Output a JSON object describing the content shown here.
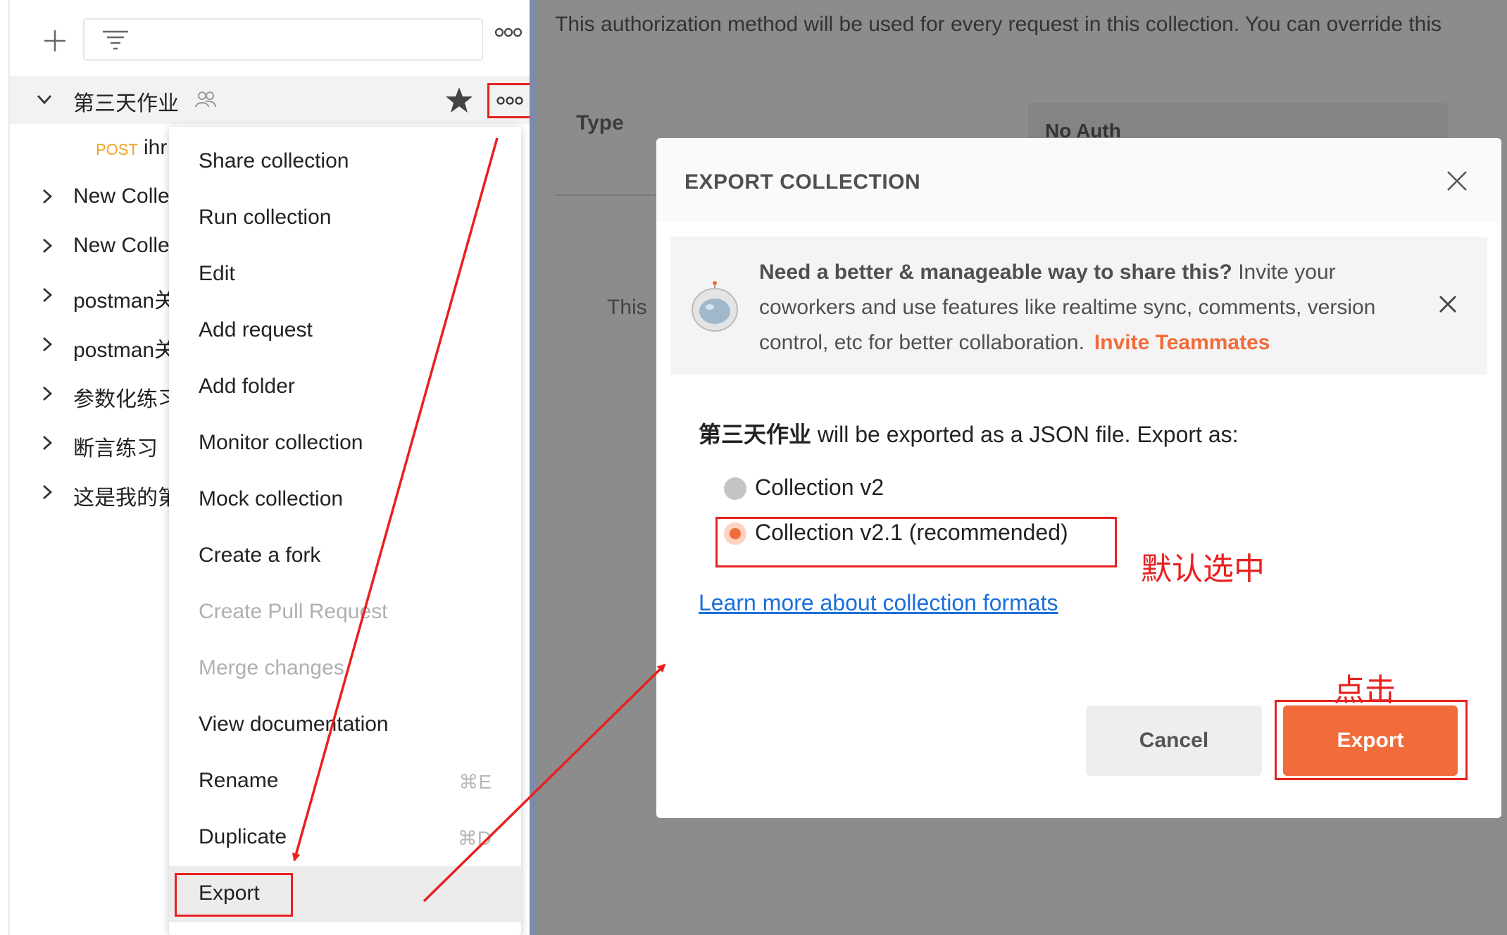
{
  "sidebar": {
    "collection": {
      "name": "第三天作业"
    },
    "request": {
      "method": "POST",
      "name": "ihr"
    },
    "collections": [
      {
        "label": "New Colle"
      },
      {
        "label": "New Colle"
      },
      {
        "label": "postman关"
      },
      {
        "label": "postman关"
      },
      {
        "label": "参数化练习"
      },
      {
        "label": "断言练习"
      },
      {
        "label": "这是我的第"
      }
    ]
  },
  "context_menu": {
    "items": [
      {
        "label": "Share collection"
      },
      {
        "label": "Run collection"
      },
      {
        "label": "Edit"
      },
      {
        "label": "Add request"
      },
      {
        "label": "Add folder"
      },
      {
        "label": "Monitor collection"
      },
      {
        "label": "Mock collection"
      },
      {
        "label": "Create a fork"
      },
      {
        "label": "Create Pull Request"
      },
      {
        "label": "Merge changes"
      },
      {
        "label": "View documentation"
      },
      {
        "label": "Rename",
        "shortcut": "⌘E"
      },
      {
        "label": "Duplicate",
        "shortcut": "⌘D"
      },
      {
        "label": "Export"
      }
    ]
  },
  "main": {
    "auth_description": "This authorization method will be used for every request in this collection. You can override this",
    "type_label": "Type",
    "auth_type": "No Auth",
    "partial_text": "This"
  },
  "modal": {
    "title": "EXPORT COLLECTION",
    "banner": {
      "strong": "Need a better & manageable way to share this?",
      "text": " Invite your coworkers and use features like realtime sync, comments, version control, etc for better collaboration.",
      "link": "Invite Teammates"
    },
    "export_name": "第三天作业",
    "export_text": " will be exported as a JSON file. Export as:",
    "options": [
      {
        "label": "Collection v2",
        "checked": false
      },
      {
        "label": "Collection v2.1 (recommended)",
        "checked": true
      }
    ],
    "learn_link": "Learn more about collection formats",
    "cancel_label": "Cancel",
    "export_label": "Export"
  },
  "annotations": {
    "default_selected": "默认选中",
    "click": "点击"
  },
  "colors": {
    "accent": "#f26b3a",
    "annotation": "#e8201f",
    "link": "#1a6fd9",
    "method_post": "#f0a020"
  }
}
